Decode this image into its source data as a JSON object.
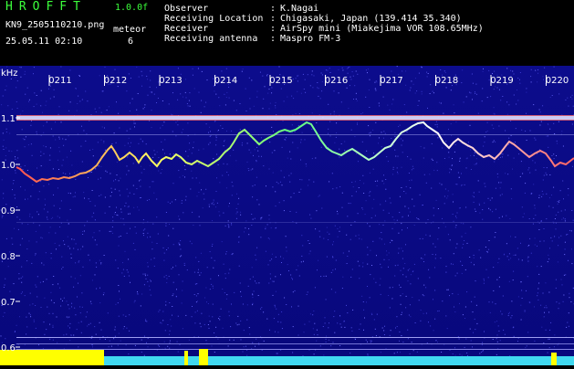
{
  "header": {
    "program": "HROFFT",
    "version": "1.0.0f",
    "filename": "KN9_2505110210.png",
    "meteor_label": "meteor",
    "meteor_count": "6",
    "timestamp": "25.05.11 02:10"
  },
  "info": [
    {
      "label": "Observer",
      "value": "K.Nagai"
    },
    {
      "label": "Receiving Location",
      "value": "Chigasaki, Japan (139.414 35.340)"
    },
    {
      "label": "Receiver",
      "value": "AirSpy mini (Miakejima VOR 108.65MHz)"
    },
    {
      "label": "Receiving antenna",
      "value": "Maspro FM-3"
    }
  ],
  "plot": {
    "unit": "kHz",
    "y_ticks": [
      "1.1",
      "1.0",
      "0.9",
      "0.8",
      "0.7",
      "0.6"
    ],
    "time_ticks": [
      "0211",
      "0212",
      "0213",
      "0214",
      "0215",
      "0216",
      "0217",
      "0218",
      "0219",
      "0220"
    ]
  },
  "colors": {
    "background": "#0a0a88",
    "text_green": "#3cff3c",
    "text_white": "#ffffff",
    "bottom_bar": "#40e0f0",
    "yellow_bar": "#ffff00"
  }
}
